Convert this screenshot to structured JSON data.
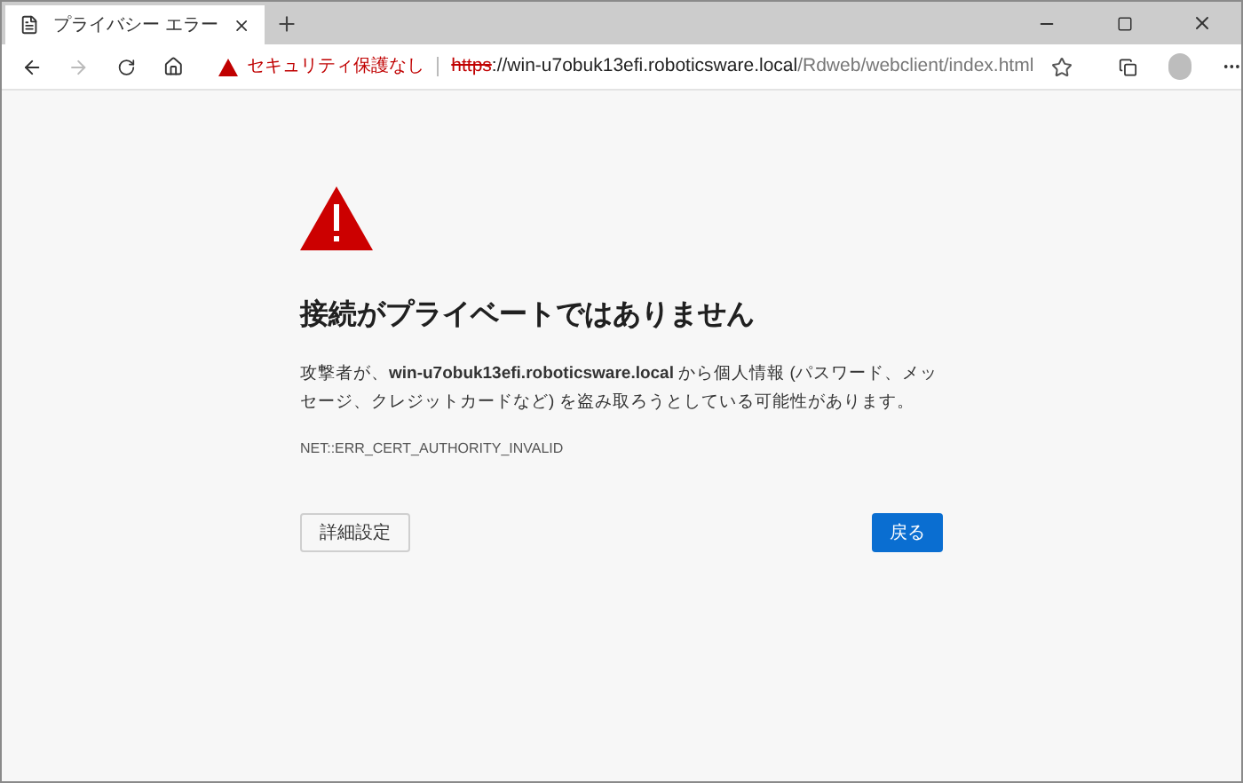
{
  "tab": {
    "title": "プライバシー エラー",
    "selected": true
  },
  "toolbar": {
    "security_label": "セキュリティ保護なし",
    "url": {
      "scheme": "https",
      "host": "://win-u7obuk13efi.roboticsware.local",
      "path": "/Rdweb/webclient/index.html"
    }
  },
  "error": {
    "heading": "接続がプライベートではありません",
    "message": "攻撃者が、**win-u7obuk13efi.roboticsware.local** から個人情報 (パスワード、メッセージ、クレジットカードなど) を盗み取ろうとしている可能性があります。",
    "code": "NET::ERR_CERT_AUTHORITY_INVALID"
  },
  "buttons": [
    {
      "label": "詳細設定",
      "kind": "secondary"
    },
    {
      "label": "戻る",
      "kind": "primary"
    }
  ]
}
